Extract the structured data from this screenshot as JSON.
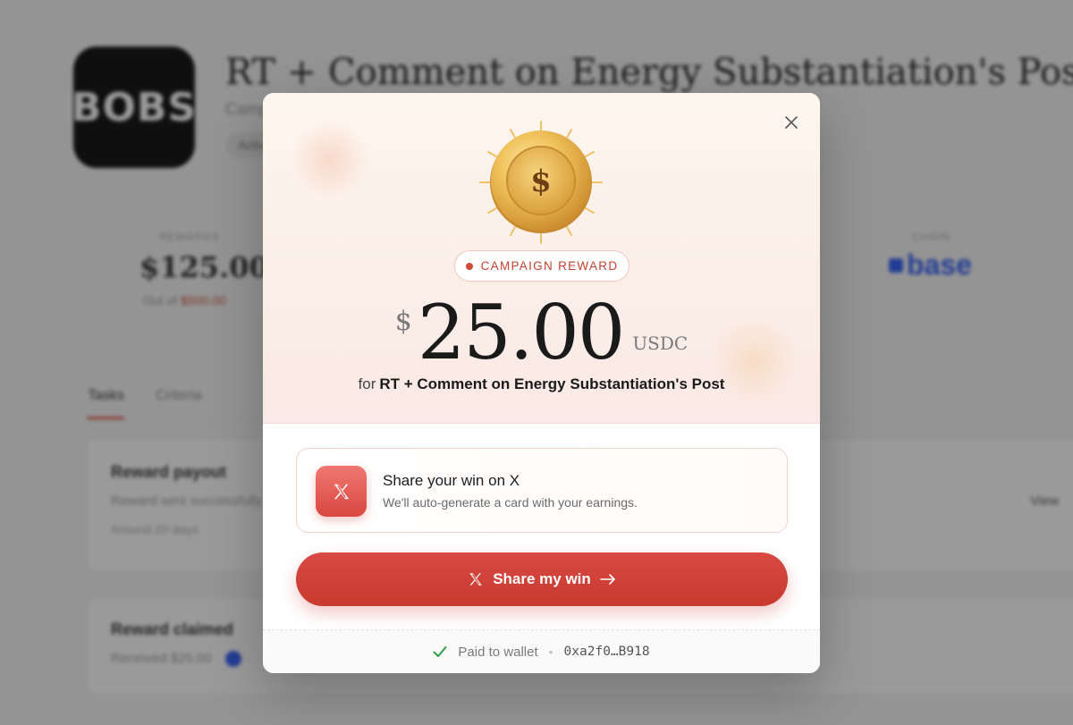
{
  "background": {
    "logo_text": "BOBS",
    "title": "RT + Comment on Energy Substantiation's Post",
    "subtitle": "Campaign",
    "chip": "Active",
    "stat_label": "REWARDS",
    "stat_value": "$125.00",
    "stat_sub_prefix": "Out of ",
    "stat_sub_highlight": "$500.00",
    "chain_label": "CHAIN",
    "chain_value": "base",
    "tabs": [
      {
        "label": "Tasks"
      },
      {
        "label": "Criteria"
      }
    ],
    "card1": {
      "title": "Reward payout",
      "text": "Reward sent successfully",
      "time": "Around 20 days",
      "link": "View"
    },
    "card2": {
      "title": "Reward claimed",
      "text": "Received $25.00"
    }
  },
  "modal": {
    "close_icon": "close-icon",
    "coin_symbol": "$",
    "badge": "CAMPAIGN REWARD",
    "amount": {
      "currency_symbol": "$",
      "value": "25.00",
      "unit": "USDC"
    },
    "for_word": "for",
    "campaign_name": "RT + Comment on Energy Substantiation's Post",
    "share_card": {
      "icon": "x-logo-icon",
      "title": "Share your win on X",
      "subtitle": "We'll auto-generate a card with your earnings."
    },
    "cta": {
      "label": "Share my win",
      "icon": "x-logo-icon",
      "arrow_icon": "arrow-right-icon"
    },
    "footer": {
      "label": "Paid to wallet",
      "separator": "•",
      "wallet": "0xa2f0…B918"
    }
  },
  "colors": {
    "accent": "#d14a3c",
    "coin_gold": "#e7b04a",
    "chain_blue": "#2f5cf5",
    "success_green": "#2e9e4f"
  }
}
